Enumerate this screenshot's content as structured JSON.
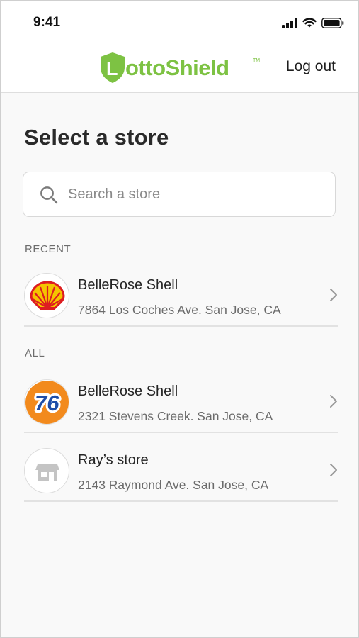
{
  "status_bar": {
    "time": "9:41"
  },
  "header": {
    "brand": "LottoShield",
    "logout_label": "Log out",
    "brand_color": "#7dc243"
  },
  "page": {
    "title": "Select a store"
  },
  "search": {
    "placeholder": "Search a store",
    "value": ""
  },
  "sections": {
    "recent_label": "RECENT",
    "all_label": "ALL"
  },
  "recent_stores": [
    {
      "name": "BelleRose Shell",
      "address": "7864 Los Coches Ave. San Jose, CA",
      "icon": "shell-logo-icon"
    }
  ],
  "all_stores": [
    {
      "name": "BelleRose Shell",
      "address": "2321 Stevens Creek. San Jose, CA",
      "icon": "76-logo-icon"
    },
    {
      "name": "Ray’s store",
      "address": "2143 Raymond Ave. San Jose, CA",
      "icon": "storefront-icon"
    }
  ],
  "icons": {
    "search": "search-icon",
    "chevron": "chevron-right-icon",
    "signal": "cellular-signal-icon",
    "wifi": "wifi-icon",
    "battery": "battery-icon"
  }
}
